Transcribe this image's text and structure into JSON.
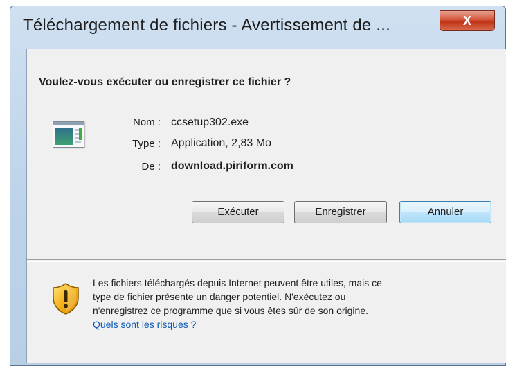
{
  "window": {
    "title": "Téléchargement de fichiers - Avertissement de ...",
    "close_label": "X"
  },
  "dialog": {
    "question": "Voulez-vous exécuter ou enregistrer ce fichier ?",
    "fields": {
      "name_label": "Nom :",
      "name_value": "ccsetup302.exe",
      "type_label": "Type :",
      "type_value": "Application, 2,83 Mo",
      "from_label": "De :",
      "from_value": "download.piriform.com"
    },
    "buttons": {
      "run": "Exécuter",
      "save": "Enregistrer",
      "cancel": "Annuler"
    },
    "warning": {
      "icon": "shield-warning-icon",
      "lines": [
        "Les fichiers téléchargés depuis Internet peuvent être utiles, mais ce",
        "type de fichier présente un danger potentiel. N'exécutez ou",
        "n'enregistrez ce programme que si vous êtes sûr de son origine."
      ],
      "link": "Quels sont les risques ?"
    }
  },
  "colors": {
    "link": "#0d59b5",
    "close_button": "#c03418",
    "frame": "#bcd2e9"
  }
}
